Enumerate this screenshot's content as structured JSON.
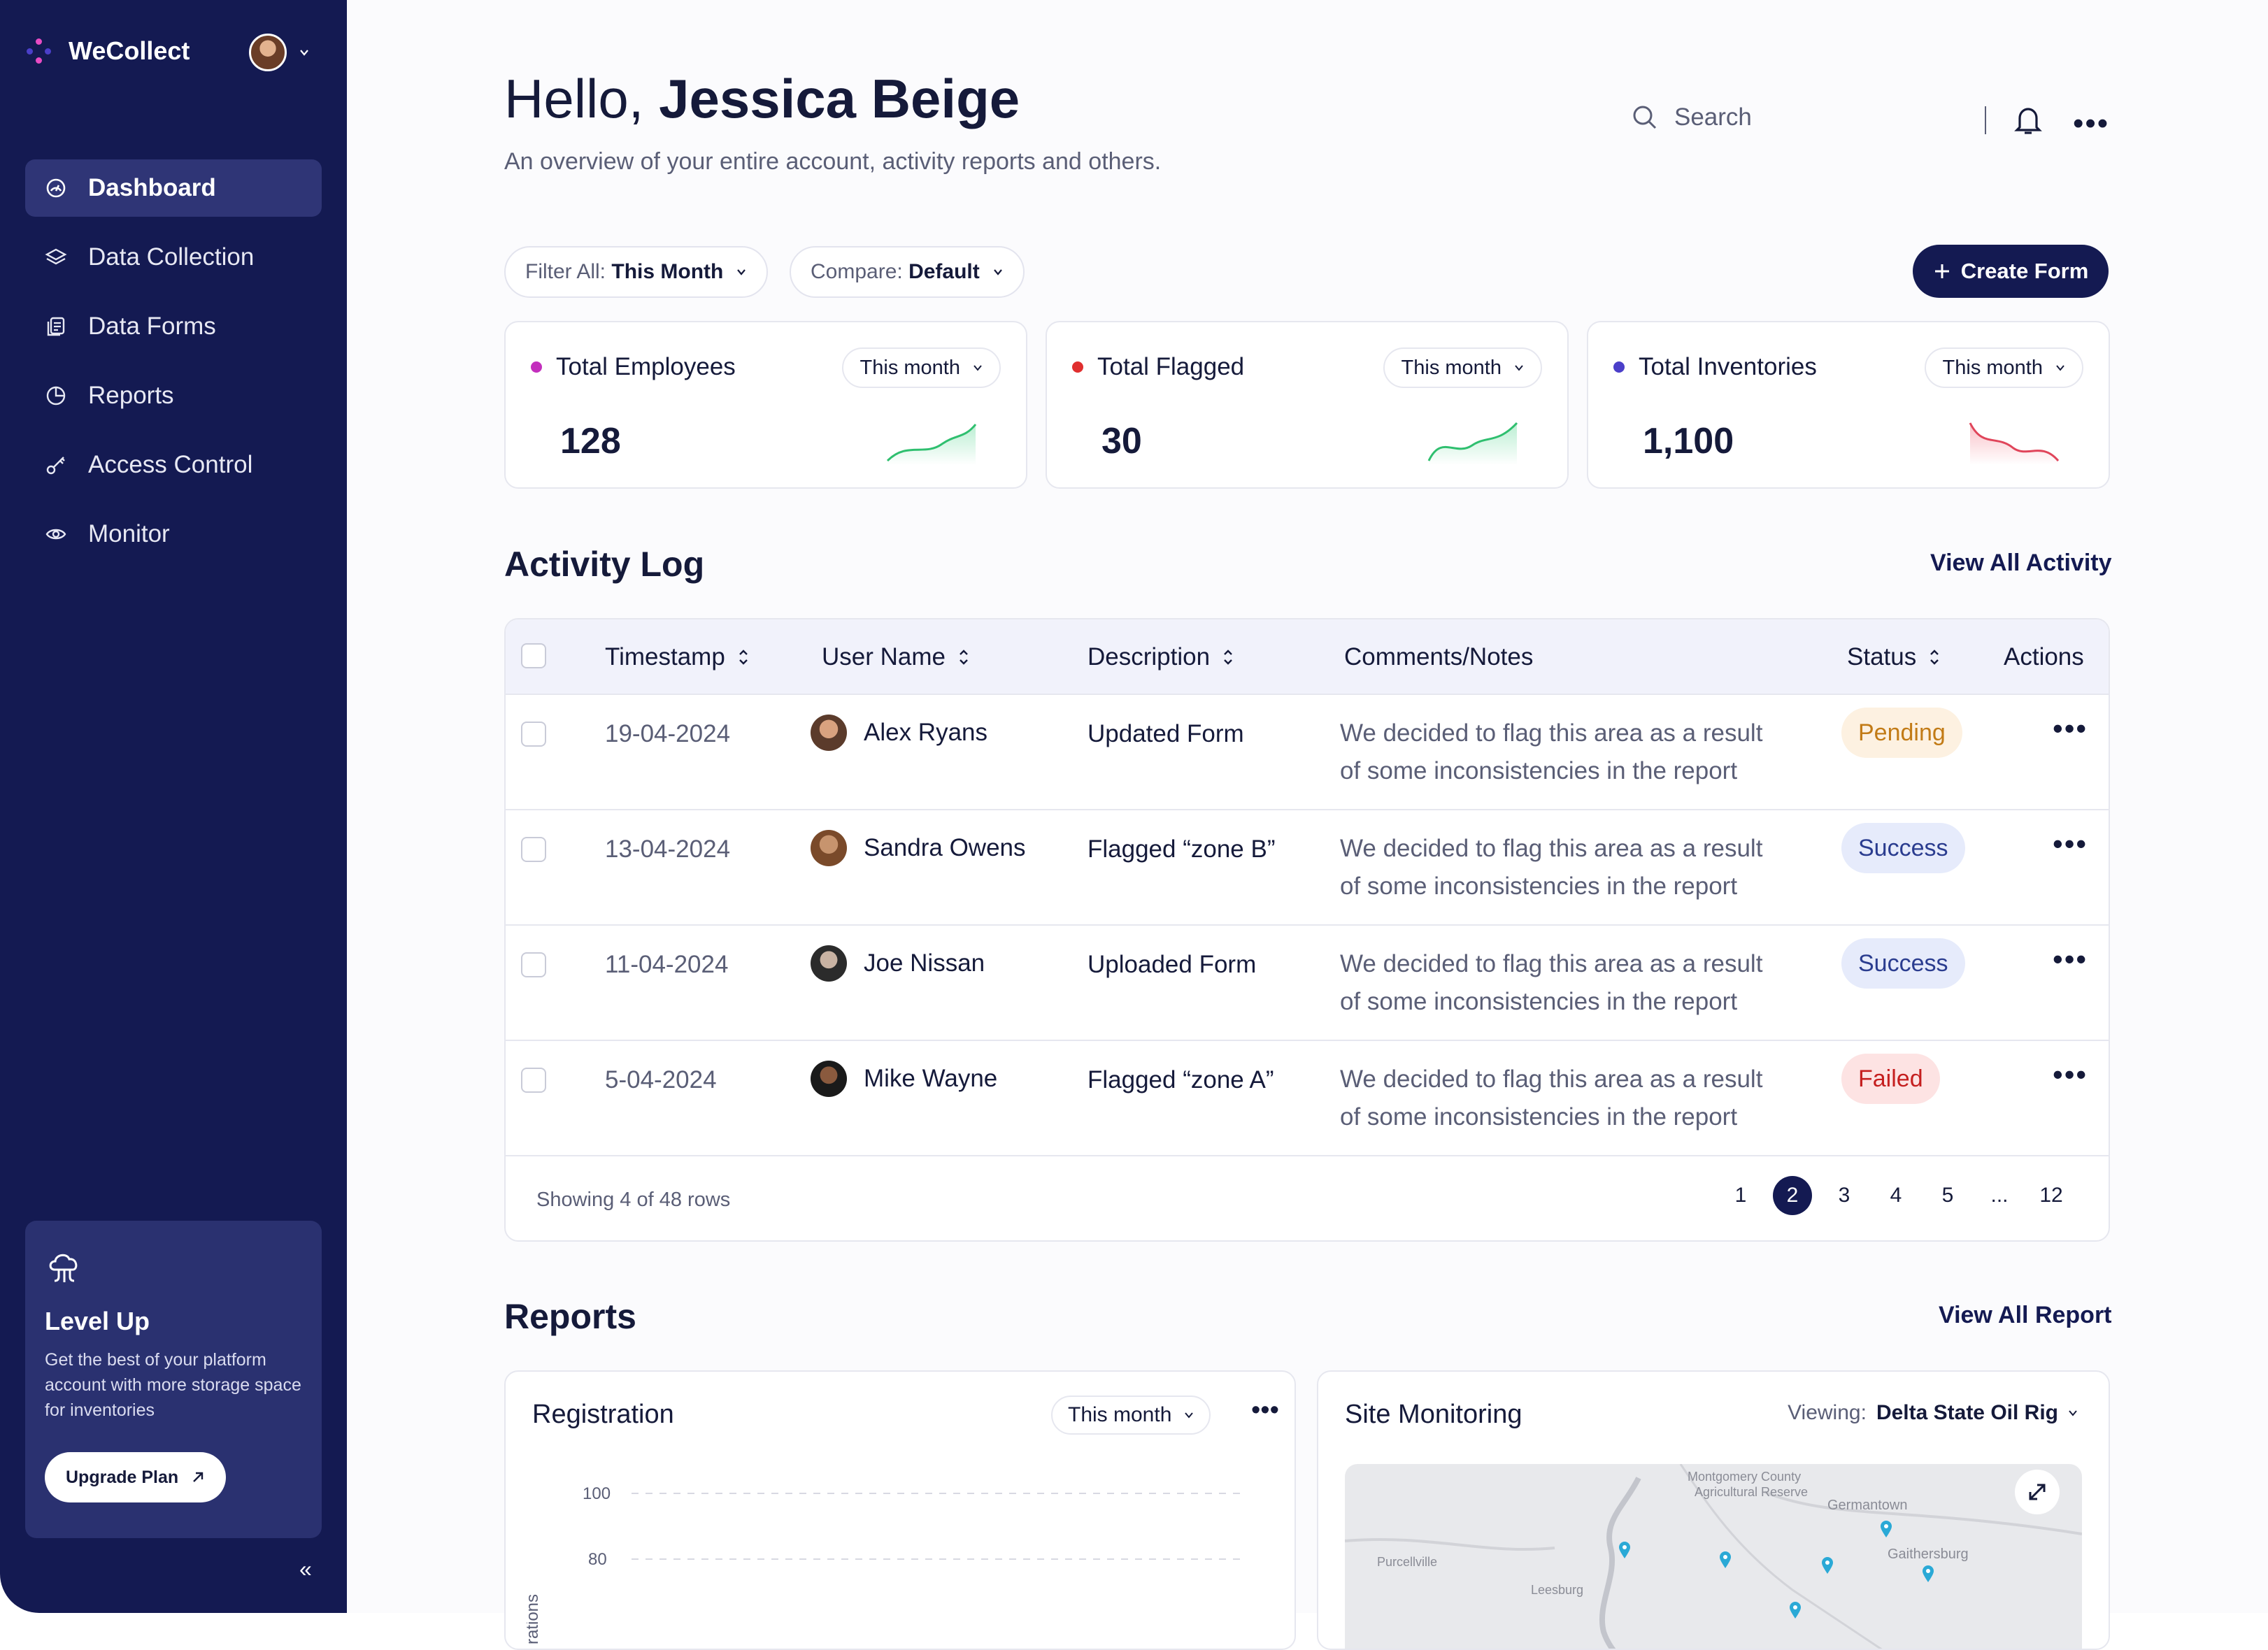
{
  "app": {
    "name": "WeCollect"
  },
  "sidebar": {
    "items": [
      {
        "label": "Dashboard",
        "icon": "dashboard-icon",
        "active": true
      },
      {
        "label": "Data Collection",
        "icon": "layers-icon",
        "active": false
      },
      {
        "label": "Data Forms",
        "icon": "forms-icon",
        "active": false
      },
      {
        "label": "Reports",
        "icon": "pie-chart-icon",
        "active": false
      },
      {
        "label": "Access Control",
        "icon": "key-icon",
        "active": false
      },
      {
        "label": "Monitor",
        "icon": "eye-icon",
        "active": false
      }
    ],
    "upgrade": {
      "title": "Level Up",
      "text": "Get the best of your platform account with more storage space for inventories",
      "button": "Upgrade Plan"
    },
    "collapse": "«"
  },
  "header": {
    "greeting": "Hello,",
    "user_name": "Jessica Beige",
    "subtitle": "An overview of your entire account, activity reports and others.",
    "search_placeholder": "Search"
  },
  "filters": {
    "filter_label": "Filter All:",
    "filter_value": "This Month",
    "compare_label": "Compare:",
    "compare_value": "Default",
    "create_button": "Create Form"
  },
  "stats": [
    {
      "label": "Total Employees",
      "value": "128",
      "period": "This month",
      "color": "#c32fbd",
      "trend": "up"
    },
    {
      "label": "Total Flagged",
      "value": "30",
      "period": "This month",
      "color": "#e02f2f",
      "trend": "up"
    },
    {
      "label": "Total Inventories",
      "value": "1,100",
      "period": "This month",
      "color": "#4b3fc9",
      "trend": "down"
    }
  ],
  "activity": {
    "title": "Activity Log",
    "view_all": "View All Activity",
    "columns": [
      "Timestamp",
      "User Name",
      "Description",
      "Comments/Notes",
      "Status",
      "Actions"
    ],
    "rows": [
      {
        "timestamp": "19-04-2024",
        "user": "Alex Ryans",
        "description": "Updated Form",
        "note_line1": "We decided to flag this area as a result",
        "note_line2": "of some inconsistencies in the report",
        "status": "Pending"
      },
      {
        "timestamp": "13-04-2024",
        "user": "Sandra Owens",
        "description": "Flagged “zone B”",
        "note_line1": "We decided to flag this area as a result",
        "note_line2": "of some inconsistencies in the report",
        "status": "Success"
      },
      {
        "timestamp": "11-04-2024",
        "user": "Joe Nissan",
        "description": "Uploaded Form",
        "note_line1": "We decided to flag this area as a result",
        "note_line2": "of some inconsistencies in the report",
        "status": "Success"
      },
      {
        "timestamp": "5-04-2024",
        "user": "Mike Wayne",
        "description": "Flagged “zone A”",
        "note_line1": "We decided to flag this area as a result",
        "note_line2": "of some inconsistencies in the report",
        "status": "Failed"
      }
    ],
    "footer": "Showing 4 of 48 rows",
    "pages": [
      "1",
      "2",
      "3",
      "4",
      "5",
      "...",
      "12"
    ],
    "active_page": "2"
  },
  "reports": {
    "title": "Reports",
    "view_all": "View All Report",
    "registration": {
      "title": "Registration",
      "period": "This month",
      "y_ticks": [
        "100",
        "80"
      ],
      "y_label": "rations"
    },
    "site": {
      "title": "Site Monitoring",
      "viewing_label": "Viewing:",
      "viewing_value": "Delta State Oil Rig",
      "map_labels": [
        "Montgomery County",
        "Agricultural Reserve",
        "Germantown",
        "Purcellville",
        "Gaithersburg",
        "Leesburg"
      ]
    }
  },
  "colors": {
    "sidebar": "#141a52",
    "accent": "#141a52",
    "pending_bg": "#fdf1e1",
    "pending_text": "#c27b16",
    "success_bg": "#e6ebfb",
    "success_text": "#2a3c8f",
    "failed_bg": "#fde3e3",
    "failed_text": "#c51f1f"
  }
}
